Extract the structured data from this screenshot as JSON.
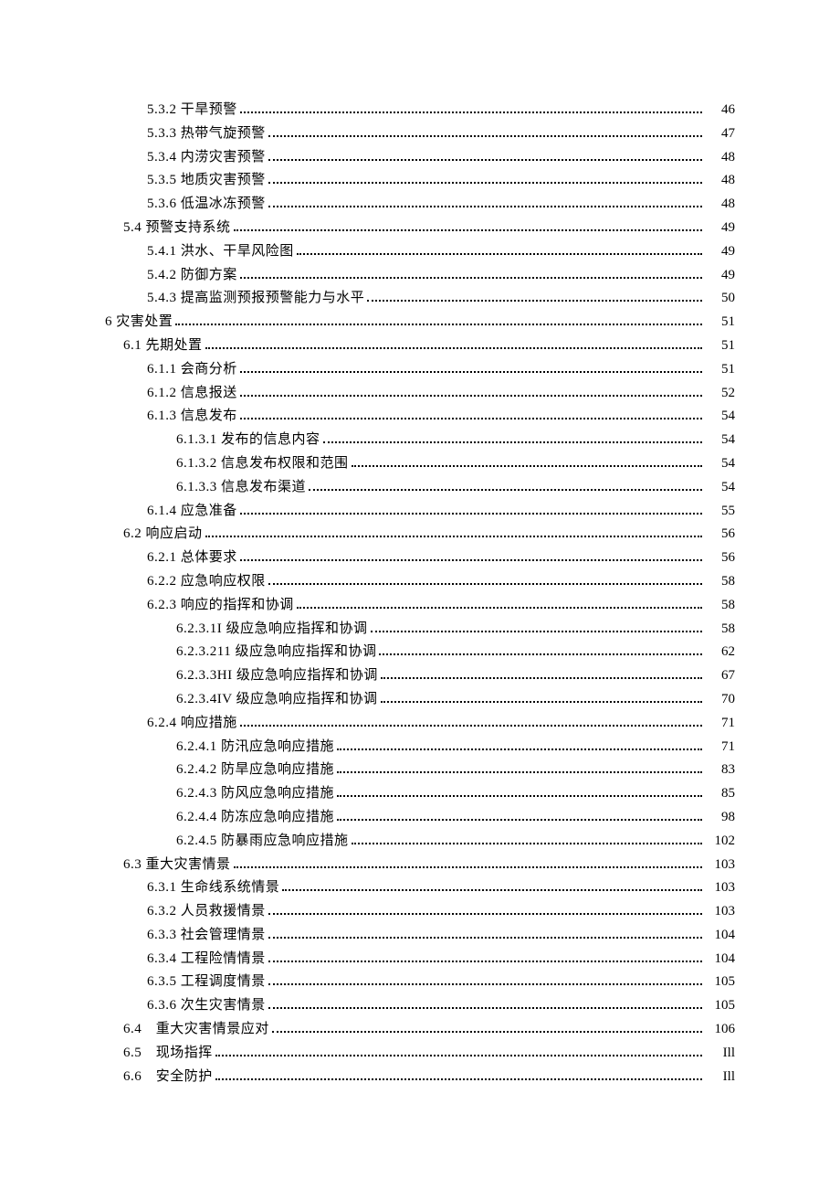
{
  "toc": [
    {
      "level": 2,
      "label": "5.3.2 干旱预警",
      "page": "46"
    },
    {
      "level": 2,
      "label": "5.3.3 热带气旋预警",
      "page": "47"
    },
    {
      "level": 2,
      "label": "5.3.4 内涝灾害预警",
      "page": "48"
    },
    {
      "level": 2,
      "label": "5.3.5 地质灾害预警",
      "page": "48"
    },
    {
      "level": 2,
      "label": "5.3.6 低温冰冻预警",
      "page": "48"
    },
    {
      "level": 1,
      "label": "5.4 预警支持系统",
      "page": "49"
    },
    {
      "level": 2,
      "label": "5.4.1 洪水、干旱风险图",
      "page": "49"
    },
    {
      "level": 2,
      "label": "5.4.2 防御方案",
      "page": "49"
    },
    {
      "level": 2,
      "label": "5.4.3 提高监测预报预警能力与水平",
      "page": "50"
    },
    {
      "level": 0,
      "label": "6 灾害处置",
      "page": "51"
    },
    {
      "level": 1,
      "label": "6.1 先期处置",
      "page": "51"
    },
    {
      "level": 2,
      "label": "6.1.1 会商分析",
      "page": "51"
    },
    {
      "level": 2,
      "label": "6.1.2 信息报送",
      "page": "52"
    },
    {
      "level": 2,
      "label": "6.1.3 信息发布",
      "page": "54"
    },
    {
      "level": 3,
      "label": "6.1.3.1 发布的信息内容",
      "page": "54"
    },
    {
      "level": 3,
      "label": "6.1.3.2 信息发布权限和范围",
      "page": "54"
    },
    {
      "level": 3,
      "label": "6.1.3.3 信息发布渠道",
      "page": "54"
    },
    {
      "level": 2,
      "label": "6.1.4 应急准备",
      "page": "55"
    },
    {
      "level": 1,
      "label": "6.2 响应启动",
      "page": "56"
    },
    {
      "level": 2,
      "label": "6.2.1 总体要求",
      "page": "56"
    },
    {
      "level": 2,
      "label": "6.2.2 应急响应权限",
      "page": "58"
    },
    {
      "level": 2,
      "label": "6.2.3 响应的指挥和协调",
      "page": "58"
    },
    {
      "level": 3,
      "label": "6.2.3.1I 级应急响应指挥和协调",
      "page": "58"
    },
    {
      "level": 3,
      "label": "6.2.3.211 级应急响应指挥和协调",
      "page": "62"
    },
    {
      "level": 3,
      "label": "6.2.3.3HI 级应急响应指挥和协调",
      "page": "67"
    },
    {
      "level": 3,
      "label": "6.2.3.4IV 级应急响应指挥和协调",
      "page": "70"
    },
    {
      "level": 2,
      "label": "6.2.4 响应措施",
      "page": "71"
    },
    {
      "level": 3,
      "label": "6.2.4.1 防汛应急响应措施",
      "page": "71"
    },
    {
      "level": 3,
      "label": "6.2.4.2 防旱应急响应措施",
      "page": "83"
    },
    {
      "level": 3,
      "label": "6.2.4.3 防风应急响应措施",
      "page": "85"
    },
    {
      "level": 3,
      "label": "6.2.4.4 防冻应急响应措施",
      "page": "98"
    },
    {
      "level": 3,
      "label": "6.2.4.5 防暴雨应急响应措施",
      "page": "102"
    },
    {
      "level": 1,
      "label": "6.3 重大灾害情景",
      "page": "103"
    },
    {
      "level": 2,
      "label": "6.3.1 生命线系统情景",
      "page": "103"
    },
    {
      "level": 2,
      "label": "6.3.2 人员救援情景",
      "page": "103"
    },
    {
      "level": 2,
      "label": "6.3.3 社会管理情景",
      "page": "104"
    },
    {
      "level": 2,
      "label": "6.3.4 工程险情情景",
      "page": "104"
    },
    {
      "level": 2,
      "label": "6.3.5 工程调度情景",
      "page": "105"
    },
    {
      "level": 2,
      "label": "6.3.6 次生灾害情景",
      "page": "105"
    },
    {
      "level": 1,
      "label": "6.4　重大灾害情景应对",
      "page": "106"
    },
    {
      "level": 1,
      "label": "6.5　现场指挥",
      "page": "Ill"
    },
    {
      "level": 1,
      "label": "6.6　安全防护",
      "page": "Ill"
    }
  ]
}
